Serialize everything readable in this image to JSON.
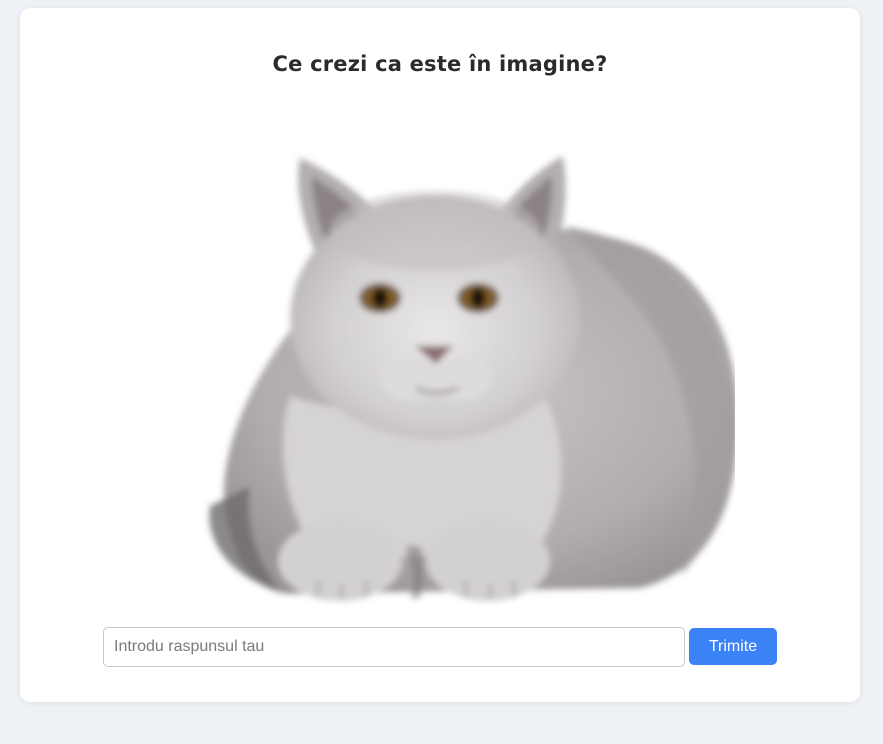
{
  "quiz": {
    "question": "Ce crezi ca este în imagine?",
    "image_subject": "grey cat (blurred photo)",
    "answer_placeholder": "Introdu raspunsul tau",
    "answer_value": "",
    "submit_label": "Trimite"
  },
  "colors": {
    "page_background": "#eef1f5",
    "card_background": "#ffffff",
    "accent": "#3b82f6",
    "title_text": "#2b2b2b"
  }
}
